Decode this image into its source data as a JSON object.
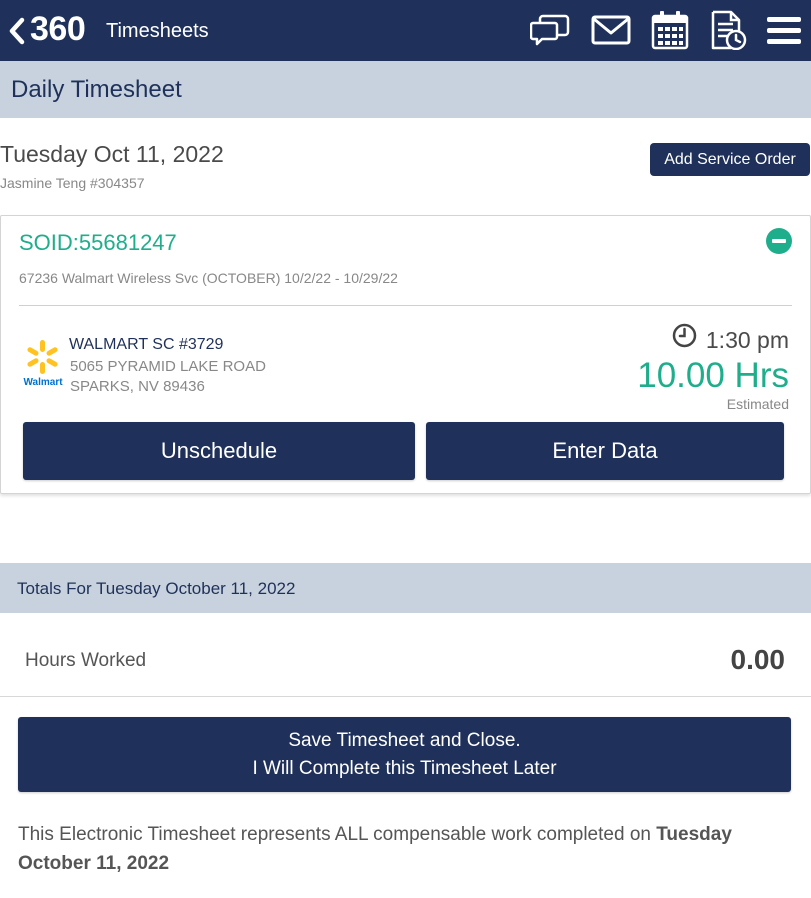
{
  "header": {
    "brand": "360",
    "app_title": "Timesheets",
    "icons": [
      "back-icon",
      "chat-icon",
      "mail-icon",
      "calendar-icon",
      "timesheet-history-icon",
      "menu-icon"
    ]
  },
  "page": {
    "section_title": "Daily Timesheet",
    "date": "Tuesday Oct 11, 2022",
    "employee": "Jasmine Teng #304357",
    "add_service_order_label": "Add Service Order"
  },
  "service_order": {
    "soid": "SOID:55681247",
    "description": "67236 Walmart Wireless Svc (OCTOBER) 10/2/22 - 10/29/22",
    "store_name": "WALMART SC #3729",
    "address_line1": "5065 PYRAMID LAKE ROAD",
    "address_line2": "SPARKS, NV 89436",
    "logo_text": "Walmart",
    "time": "1:30 pm",
    "hours": "10.00 Hrs",
    "hours_note": "Estimated",
    "unschedule_label": "Unschedule",
    "enter_data_label": "Enter Data"
  },
  "totals": {
    "title": "Totals For Tuesday October 11, 2022",
    "hours_label": "Hours Worked",
    "hours_value": "0.00"
  },
  "save": {
    "line1": "Save Timesheet and Close.",
    "line2": "I Will Complete this Timesheet Later"
  },
  "disclaimer": {
    "text": "This Electronic Timesheet represents ALL compensable work completed on ",
    "date": "Tuesday October 11, 2022"
  },
  "colors": {
    "navy": "#1f315a",
    "section_bar": "#c8d2de",
    "accent_green": "#1fae8b",
    "walmart_yellow": "#ffc220",
    "walmart_blue": "#0071ce"
  }
}
